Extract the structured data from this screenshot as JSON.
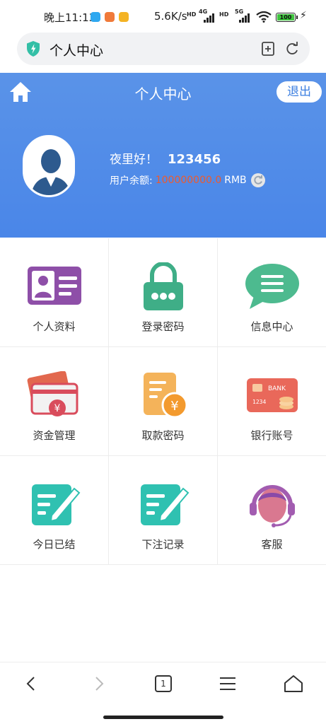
{
  "status": {
    "time": "晚上11:13",
    "net_speed": "5.6K/s",
    "indicators": [
      "HD",
      "4G",
      "HD",
      "5G"
    ],
    "battery": "100"
  },
  "urlbar": {
    "title": "个人中心",
    "icons": [
      "shield-icon",
      "bookmark-add-icon",
      "reload-icon"
    ]
  },
  "header": {
    "title": "个人中心",
    "logout_label": "退出",
    "greeting": "夜里好！",
    "username": "123456",
    "balance_label": "用户余额:",
    "balance_value": "100000000.0",
    "currency": "RMB"
  },
  "menu": [
    {
      "label": "个人资料",
      "icon": "id-card-icon"
    },
    {
      "label": "登录密码",
      "icon": "padlock-icon"
    },
    {
      "label": "信息中心",
      "icon": "chat-bubble-icon"
    },
    {
      "label": "资金管理",
      "icon": "wallet-icon"
    },
    {
      "label": "取款密码",
      "icon": "withdraw-icon"
    },
    {
      "label": "银行账号",
      "icon": "bank-card-icon"
    },
    {
      "label": "今日已结",
      "icon": "edit-note-icon"
    },
    {
      "label": "下注记录",
      "icon": "edit-note-icon"
    },
    {
      "label": "客服",
      "icon": "customer-service-icon"
    }
  ],
  "bottom_nav": {
    "tab_count": "1",
    "icons": [
      "back-icon",
      "forward-icon",
      "tabs-icon",
      "menu-icon",
      "home-icon"
    ]
  },
  "colors": {
    "header_blue": "#4a86e8",
    "balance_red": "#f05a2c",
    "logout_text": "#3c7fe0"
  }
}
